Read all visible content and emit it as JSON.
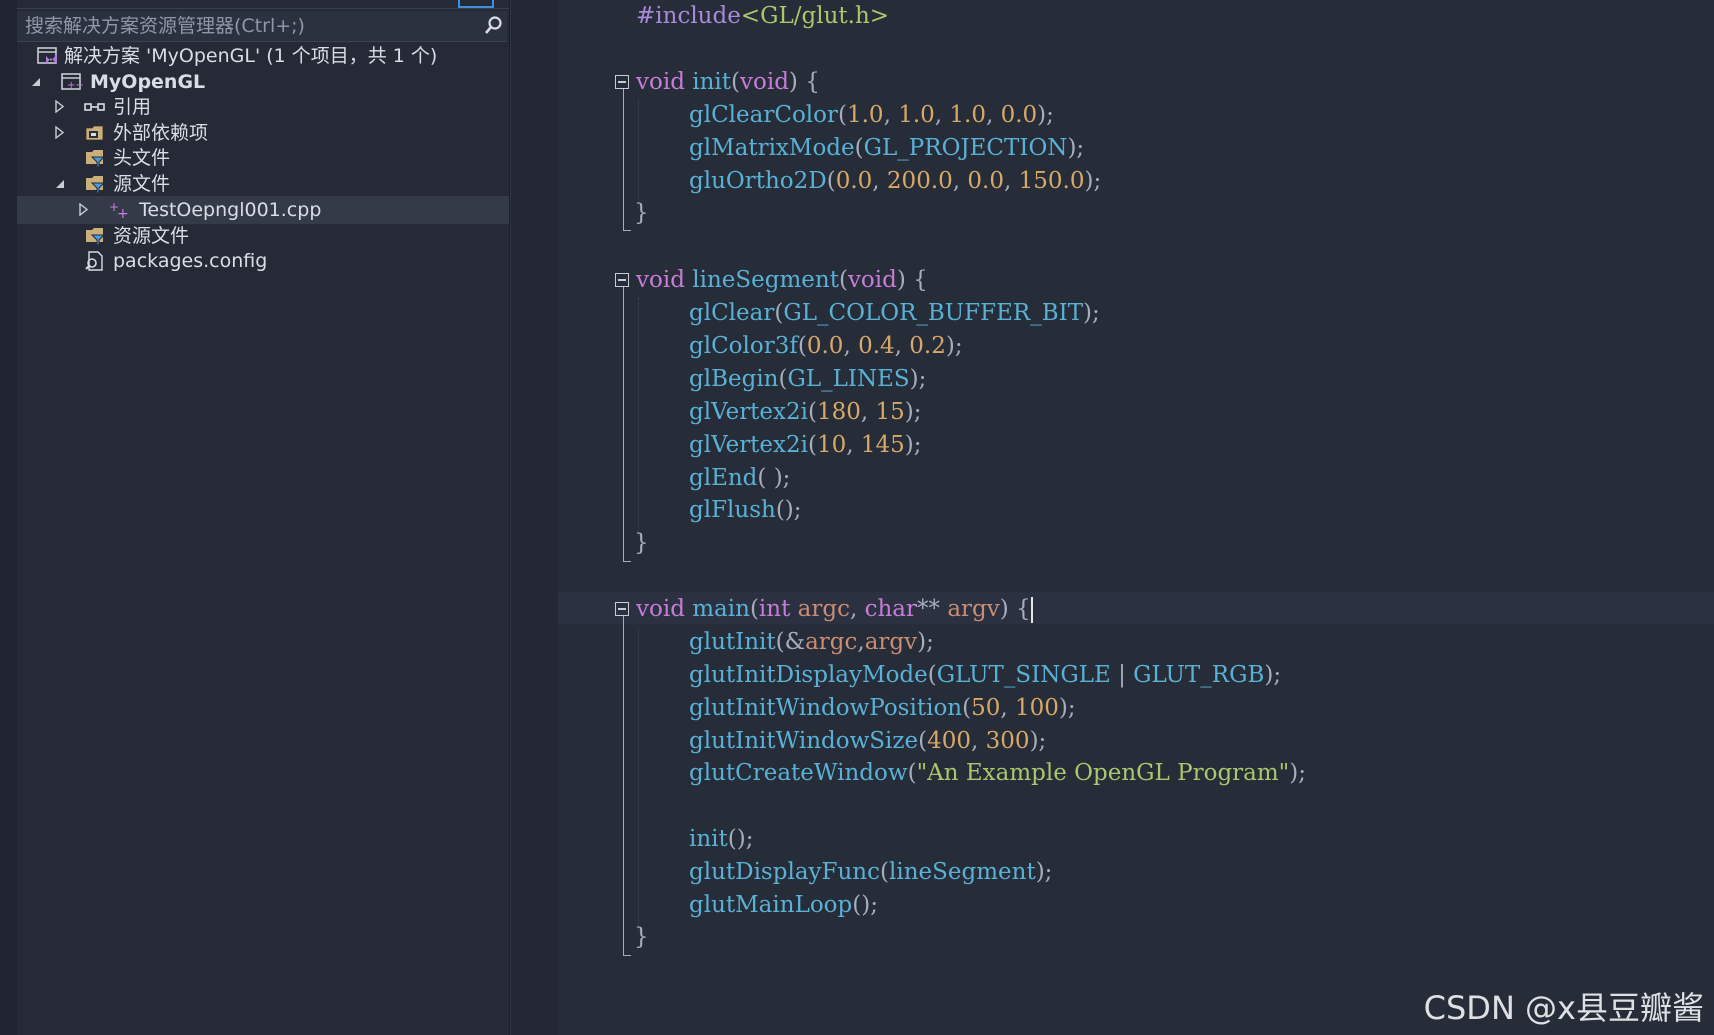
{
  "explorer": {
    "search_placeholder": "搜索解决方案资源管理器(Ctrl+;)",
    "solution_label": "解决方案 'MyOpenGL' (1 个项目，共 1 个)",
    "project_label": "MyOpenGL",
    "items": [
      {
        "label": "引用",
        "icon": "references-icon",
        "expander": "collapsed"
      },
      {
        "label": "外部依赖项",
        "icon": "external-dependencies-icon",
        "expander": "collapsed"
      },
      {
        "label": "头文件",
        "icon": "filter-folder-icon",
        "expander": "none"
      },
      {
        "label": "源文件",
        "icon": "filter-folder-icon",
        "expander": "expanded"
      },
      {
        "label": "TestOepngl001.cpp",
        "icon": "cpp-file-icon",
        "expander": "collapsed",
        "selected": true
      },
      {
        "label": "资源文件",
        "icon": "filter-folder-icon",
        "expander": "none"
      },
      {
        "label": "packages.config",
        "icon": "config-file-icon",
        "expander": "none"
      }
    ]
  },
  "editor": {
    "include_directive": "#include",
    "include_header": "<GL/glut.h>",
    "colors": {
      "keyword": "#c77dd7",
      "function": "#59b1d6",
      "number": "#d8a868",
      "string": "#a9c76c",
      "parameter": "#c98c74"
    }
  },
  "watermark": "CSDN @x县豆瓣酱"
}
